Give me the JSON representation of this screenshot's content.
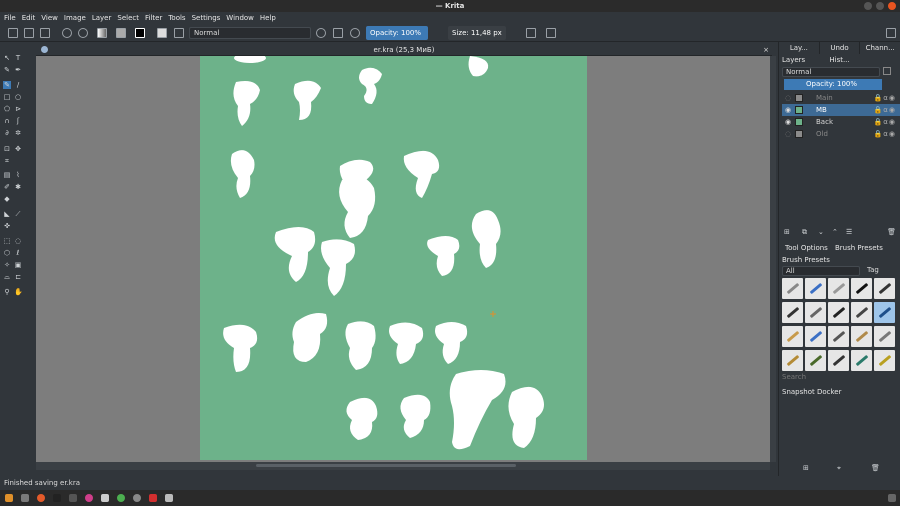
{
  "window": {
    "title": "— Krita"
  },
  "menu": [
    "File",
    "Edit",
    "View",
    "Image",
    "Layer",
    "Select",
    "Filter",
    "Tools",
    "Settings",
    "Window",
    "Help"
  ],
  "toolbar": {
    "blend_mode": "Normal",
    "opacity": "Opacity: 100%",
    "size": "Size: 11,48 px"
  },
  "document": {
    "tab_title": "er.kra (25,3 МиБ)"
  },
  "dock": {
    "tabs": [
      "Lay...",
      "Undo Hist...",
      "Chann..."
    ],
    "layers_title": "Layers",
    "blend_mode": "Normal",
    "opacity": "Opacity:  100%",
    "layers": [
      {
        "name": "Main",
        "visible": false,
        "selected": false
      },
      {
        "name": "MB",
        "visible": true,
        "selected": true
      },
      {
        "name": "Back",
        "visible": true,
        "selected": false
      },
      {
        "name": "Old",
        "visible": false,
        "selected": false
      }
    ],
    "subtabs": [
      "Tool Options",
      "Brush Presets"
    ],
    "brush_presets_title": "Brush Presets",
    "brush_filter": "All",
    "tag_label": "Tag",
    "search_placeholder": "Search",
    "snapshot_title": "Snapshot Docker"
  },
  "status": {
    "message": "Finished saving er.kra"
  },
  "colors": {
    "canvas_bg": "#7d7d7d",
    "paper": "#6db28a",
    "accent": "#3d7ab5"
  }
}
